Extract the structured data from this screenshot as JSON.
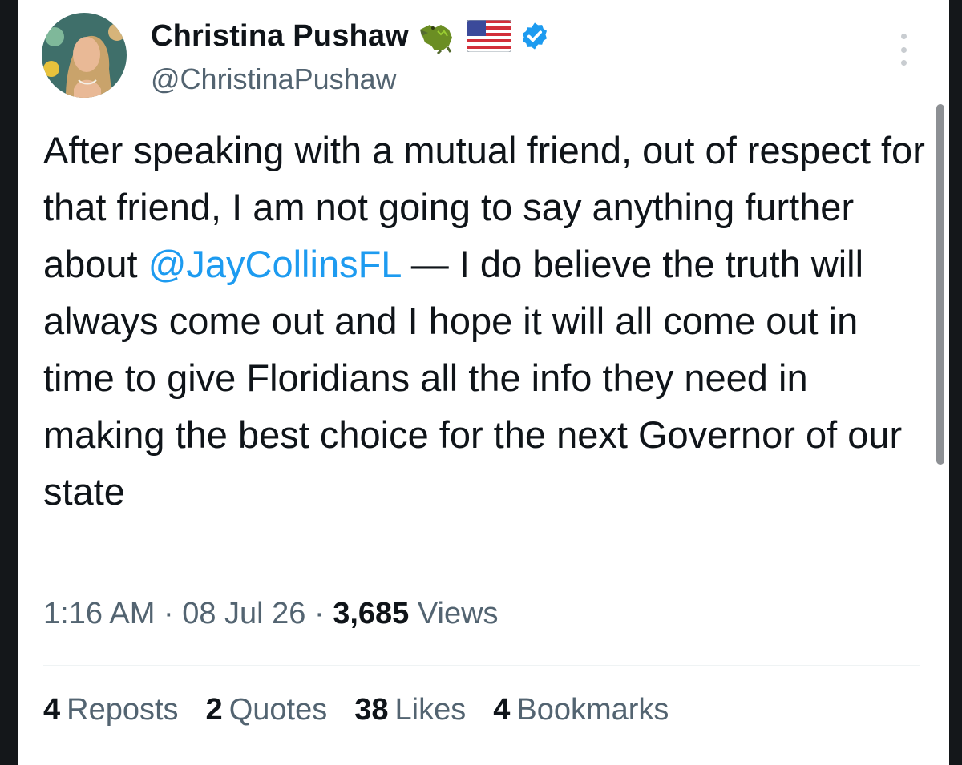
{
  "author": {
    "display_name": "Christina Pushaw",
    "handle": "@ChristinaPushaw",
    "badges": [
      "crocodile-emoji-icon",
      "us-flag-emoji-icon",
      "verified-badge-icon"
    ]
  },
  "tweet": {
    "text_before_mention": "After speaking with a mutual friend, out of respect for that friend, I am not going to say anything further about ",
    "mention": "@JayCollinsFL",
    "text_after_mention": " — I do believe the truth will always come out and I hope it will all come out in time to give Floridians all the info they need in making the best choice for the next Governor of our state"
  },
  "meta": {
    "time": "1:16 AM",
    "separator": " · ",
    "date": "08 Jul 26",
    "views_count": "3,685",
    "views_label": "Views"
  },
  "stats": [
    {
      "count": "4",
      "label": "Reposts"
    },
    {
      "count": "2",
      "label": "Quotes"
    },
    {
      "count": "38",
      "label": "Likes"
    },
    {
      "count": "4",
      "label": "Bookmarks"
    }
  ],
  "colors": {
    "accent": "#1d9bf0",
    "text": "#0f1419",
    "secondary": "#536471"
  }
}
